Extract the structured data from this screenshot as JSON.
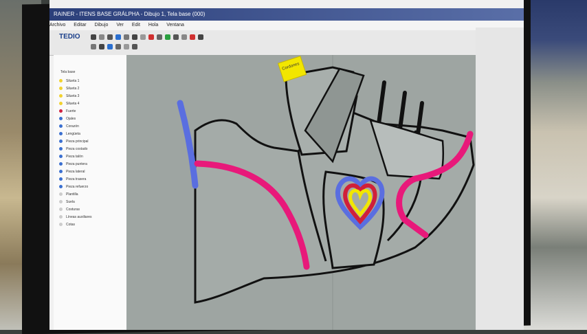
{
  "window": {
    "title": "RAINER - ITENS BASE GRÁLPHA - Dibujo 1, Tela base (000)"
  },
  "menu": {
    "items": [
      "Archivo",
      "Editar",
      "Dibujo",
      "Ver",
      "Edit",
      "Hola",
      "Ventana",
      "Ventana"
    ]
  },
  "app": {
    "logo": "TEDIO"
  },
  "tree": {
    "root": "Tela base",
    "items": [
      {
        "label": "Silueta 1",
        "color": "#f2d22e"
      },
      {
        "label": "Silueta 2",
        "color": "#f2d22e"
      },
      {
        "label": "Silueta 3",
        "color": "#f2d22e"
      },
      {
        "label": "Silueta 4",
        "color": "#f2d22e"
      },
      {
        "label": "Fuerte",
        "color": "#d02040"
      },
      {
        "label": "Ojales",
        "color": "#3a6fd0"
      },
      {
        "label": "Corazón",
        "color": "#3a6fd0"
      },
      {
        "label": "Lengüeta",
        "color": "#3a6fd0"
      },
      {
        "label": "Pieza principal",
        "color": "#3a6fd0"
      },
      {
        "label": "Pieza costado",
        "color": "#3a6fd0"
      },
      {
        "label": "Pieza talón",
        "color": "#3a6fd0"
      },
      {
        "label": "Pieza puntera",
        "color": "#3a6fd0"
      },
      {
        "label": "Pieza lateral",
        "color": "#3a6fd0"
      },
      {
        "label": "Pieza trasera",
        "color": "#3a6fd0"
      },
      {
        "label": "Pieza refuerzo",
        "color": "#3a6fd0"
      },
      {
        "label": "Plantilla",
        "color": "#cccccc"
      },
      {
        "label": "Suela",
        "color": "#cccccc"
      },
      {
        "label": "Costuras",
        "color": "#cccccc"
      },
      {
        "label": "Líneas auxiliares",
        "color": "#cccccc"
      },
      {
        "label": "Cotas",
        "color": "#cccccc"
      }
    ]
  },
  "label_tag": {
    "text": "Cordones",
    "color": "#f2e600"
  },
  "colors": {
    "outline": "#111111",
    "magenta": "#e8197a",
    "blue": "#5a6ee0",
    "yellow": "#f2e600",
    "red": "#d0203a",
    "canvas": "#9ea5a2"
  }
}
